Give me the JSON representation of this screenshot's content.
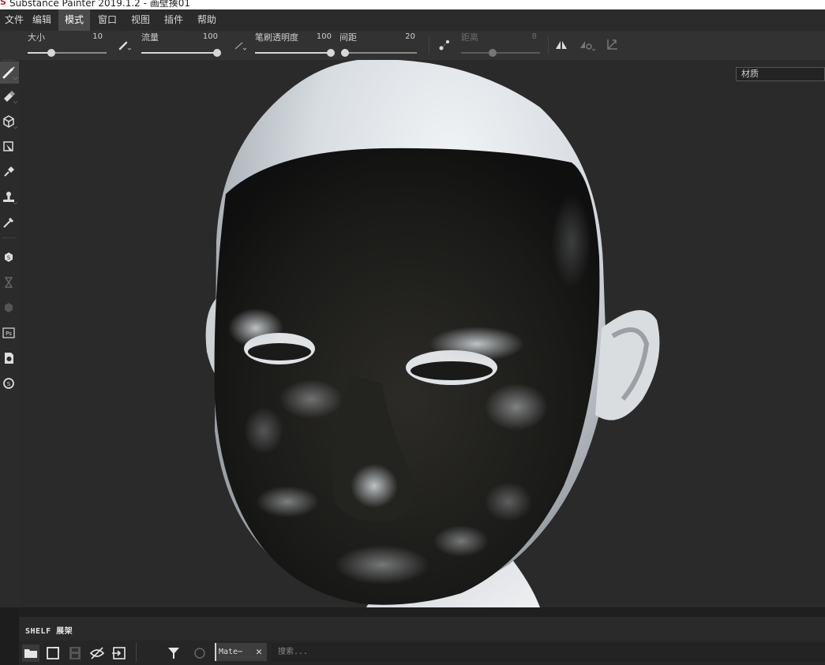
{
  "window": {
    "title": "Substance Painter 2019.1.2 - 画壁揍01"
  },
  "menu": [
    "文件",
    "编辑",
    "模式",
    "窗口",
    "视图",
    "插件",
    "帮助"
  ],
  "toolbar": {
    "size": {
      "label": "大小",
      "value": "10",
      "fraction": 0.3
    },
    "flow": {
      "label": "流量",
      "value": "100",
      "fraction": 1.0
    },
    "opacity": {
      "label": "笔刷透明度",
      "value": "100",
      "fraction": 1.0
    },
    "spacing": {
      "label": "间距",
      "value": "20",
      "fraction": 0.05
    },
    "distance": {
      "label": "距离",
      "value": "8",
      "fraction": 0.4
    }
  },
  "viewport": {
    "material_dropdown": "材质"
  },
  "shelf": {
    "title": "SHELF 展架",
    "filter_chip": "Mate⋯",
    "search_placeholder": "搜索..."
  },
  "icons": [
    "brush-icon",
    "eraser-icon",
    "projection-icon",
    "polygon-fill-icon",
    "smudge-icon",
    "clone-icon",
    "color-picker-icon",
    "substance-icon",
    "history-icon",
    "layer-icon",
    "photoshop-icon",
    "bake-icon",
    "sync-icon",
    "symmetry-icon",
    "lazy-mouse-icon",
    "snap-icon"
  ]
}
